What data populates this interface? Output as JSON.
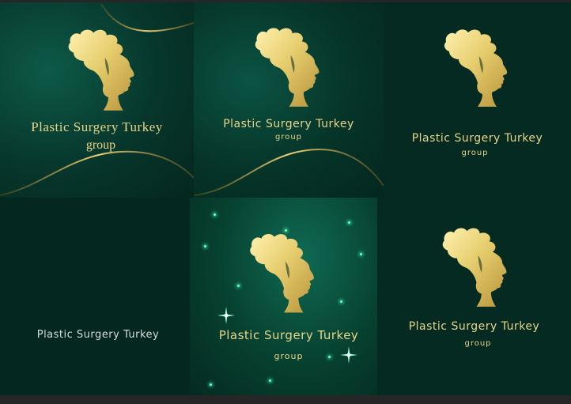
{
  "brand": {
    "name": "Plastic Surgery Turkey",
    "sub": "group"
  },
  "colors": {
    "gold": "#e8d58a",
    "deep_green": "#04271f",
    "emerald": "#0d5a47",
    "sparkle": "#3df0a8"
  },
  "icons": {
    "logo": "woman-profile-silhouette-icon",
    "sparkle": "sparkle-star-icon"
  },
  "tiles": [
    {
      "id": "tile-1",
      "title": "Plastic Surgery Turkey",
      "subtitle": "group"
    },
    {
      "id": "tile-2",
      "title": "Plastic Surgery Turkey",
      "subtitle": "group"
    },
    {
      "id": "tile-3",
      "title": "Plastic Surgery Turkey",
      "subtitle": "group"
    },
    {
      "id": "tile-4",
      "title": "Plastic Surgery Turkey"
    },
    {
      "id": "tile-5",
      "title": "Plastic Surgery Turkey",
      "subtitle": "group"
    },
    {
      "id": "tile-6",
      "title": "Plastic Surgery Turkey",
      "subtitle": "group"
    }
  ]
}
